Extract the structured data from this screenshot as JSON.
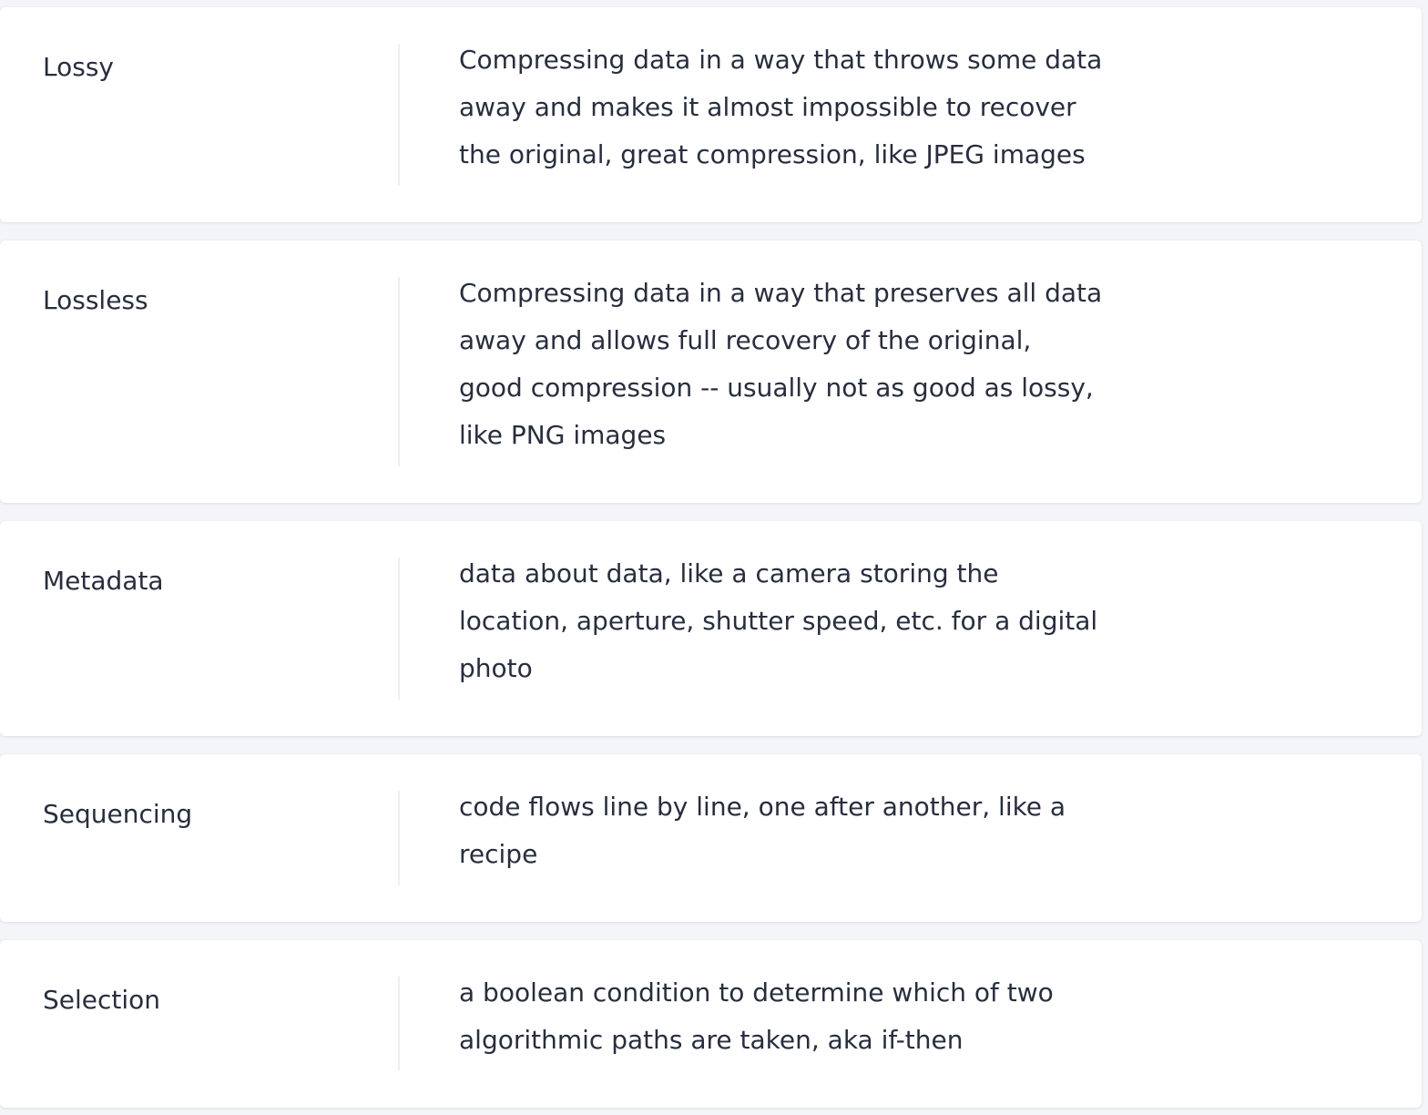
{
  "flashcards": [
    {
      "term": "Lossy",
      "definition_lines": [
        "Compressing data in a way that throws some data",
        "away and makes it almost impossible to recover",
        "the original, great compression, like JPEG images"
      ]
    },
    {
      "term": "Lossless",
      "definition_lines": [
        "Compressing data in a way that preserves all data",
        "away and allows full recovery of the original,",
        "good compression -- usually not as good as lossy,",
        "like PNG images"
      ]
    },
    {
      "term": "Metadata",
      "definition_lines": [
        "data about data, like a camera storing the",
        "location, aperture, shutter speed, etc. for a digital",
        "photo"
      ]
    },
    {
      "term": "Sequencing",
      "definition_lines": [
        "code flows line by line, one after another, like a",
        "recipe"
      ]
    },
    {
      "term": "Selection",
      "definition_lines": [
        "a boolean condition to determine which of two",
        "algorithmic paths are taken, aka if-then"
      ]
    }
  ]
}
